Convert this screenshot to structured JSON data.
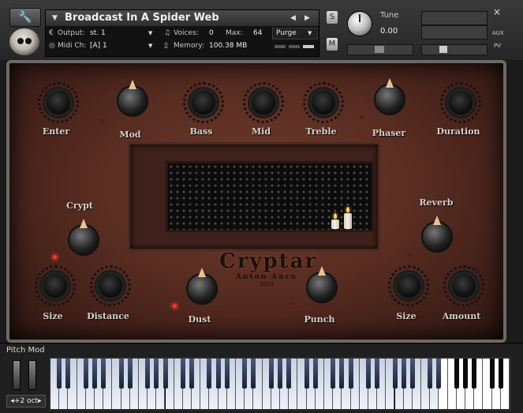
{
  "header": {
    "instrument_title": "Broadcast In A Spider Web",
    "output_label": "Output:",
    "output_value": "st. 1",
    "voices_label": "Voices:",
    "voices_value": "0",
    "max_label": "Max:",
    "max_value": "64",
    "purge_label": "Purge",
    "midi_label": "Midi Ch:",
    "midi_value": "[A]  1",
    "memory_label": "Memory:",
    "memory_value": "100.38 MB",
    "s_label": "S",
    "m_label": "M",
    "tune_label": "Tune",
    "tune_value": "0.00",
    "aux_label": "AUX",
    "pv_label": "PV",
    "close_label": "×"
  },
  "panel": {
    "knobs": {
      "enter": "Enter",
      "mod": "Mod",
      "bass": "Bass",
      "mid": "Mid",
      "treble": "Treble",
      "phaser": "Phaser",
      "duration": "Duration",
      "crypt": "Crypt",
      "reverb": "Reverb",
      "size_left": "Size",
      "distance": "Distance",
      "dust": "Dust",
      "punch": "Punch",
      "size_right": "Size",
      "amount": "Amount"
    },
    "logo": {
      "title": "Cryptar",
      "subtitle": "Anton Anru",
      "year": "2014"
    }
  },
  "keyboard": {
    "pitch_mod_label": "Pitch Mod",
    "octave_label": "+2 oct"
  }
}
